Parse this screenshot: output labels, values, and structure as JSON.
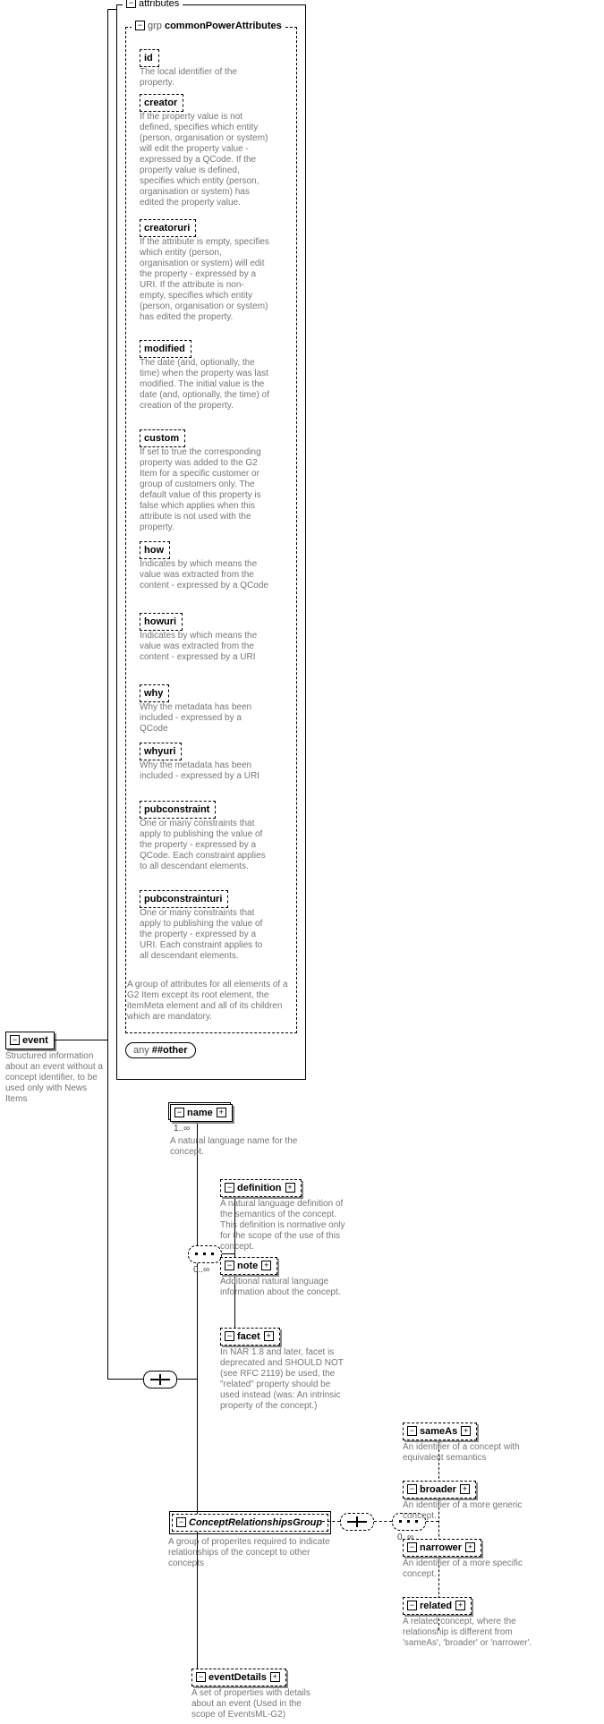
{
  "root": {
    "attributes_title": "attributes",
    "grp_keyword": "grp",
    "grp_name": "commonPowerAttributes",
    "grp_desc": "A group of attributes for all elements of a G2 Item except its root element, the itemMeta element and all of its children which are mandatory.",
    "any_other": "any ##other",
    "attrs": [
      {
        "name": "id",
        "desc": "The local identifier of the property."
      },
      {
        "name": "creator",
        "desc": "If the property value is not defined, specifies which entity (person, organisation or system) will edit the property value - expressed by a QCode. If the property value is defined, specifies which entity (person, organisation or system) has edited the property value."
      },
      {
        "name": "creatoruri",
        "desc": "If the attribute is empty, specifies which entity (person, organisation or system) will edit the property - expressed by a URI. If the attribute is non-empty, specifies which entity (person, organisation or system) has edited the property."
      },
      {
        "name": "modified",
        "desc": "The date (and, optionally, the time) when the property was last modified. The initial value is the date (and, optionally, the time) of creation of the property."
      },
      {
        "name": "custom",
        "desc": "If set to true the corresponding property was added to the G2 Item for a specific customer or group of customers only. The default value of this property is false which applies when this attribute is not used with the property."
      },
      {
        "name": "how",
        "desc": "Indicates by which means the value was extracted from the content - expressed by a QCode"
      },
      {
        "name": "howuri",
        "desc": "Indicates by which means the value was extracted from the content - expressed by a URI"
      },
      {
        "name": "why",
        "desc": "Why the metadata has been included - expressed by a QCode"
      },
      {
        "name": "whyuri",
        "desc": "Why the metadata has been included - expressed by a URI"
      },
      {
        "name": "pubconstraint",
        "desc": "One or many constraints that apply to publishing the value of the property - expressed by a QCode. Each constraint applies to all descendant elements."
      },
      {
        "name": "pubconstrainturi",
        "desc": "One or many constraints that apply to publishing the value of the property - expressed by a URI. Each constraint applies to all descendant elements."
      }
    ]
  },
  "event": {
    "name": "event",
    "desc": "Structured information about an event without a concept identifier, to be used only with News Items"
  },
  "elements": {
    "name": {
      "label": "name",
      "card": "1..∞",
      "desc": "A natural language name for the concept."
    },
    "definition": {
      "label": "definition",
      "desc": "A natural language definition of the semantics of the concept. This definition is normative only for the scope of the use of this concept."
    },
    "note": {
      "label": "note",
      "desc": "Additional natural language information about the concept."
    },
    "facet": {
      "label": "facet",
      "desc": "In NAR 1.8 and later, facet is deprecated and SHOULD NOT (see RFC 2119) be used, the \"related\" property should be used instead (was: An intrinsic property of the concept.)"
    },
    "choice_card": "0..∞",
    "crg": {
      "label": "ConceptRelationshipsGroup",
      "desc": "A group of properites required to indicate relationships of the concept to other concepts"
    },
    "crg_choice_card": "0..∞",
    "sameAs": {
      "label": "sameAs",
      "desc": "An identifier of a concept with equivalent semantics"
    },
    "broader": {
      "label": "broader",
      "desc": "An identifier of a more generic concept."
    },
    "narrower": {
      "label": "narrower",
      "desc": "An identifier of a more specific concept."
    },
    "related": {
      "label": "related",
      "desc": "A related concept, where the relationship is different from 'sameAs', 'broader' or 'narrower'."
    },
    "eventDetails": {
      "label": "eventDetails",
      "desc": "A set of properties with details about an event (Used in the scope of EventsML-G2)"
    }
  }
}
